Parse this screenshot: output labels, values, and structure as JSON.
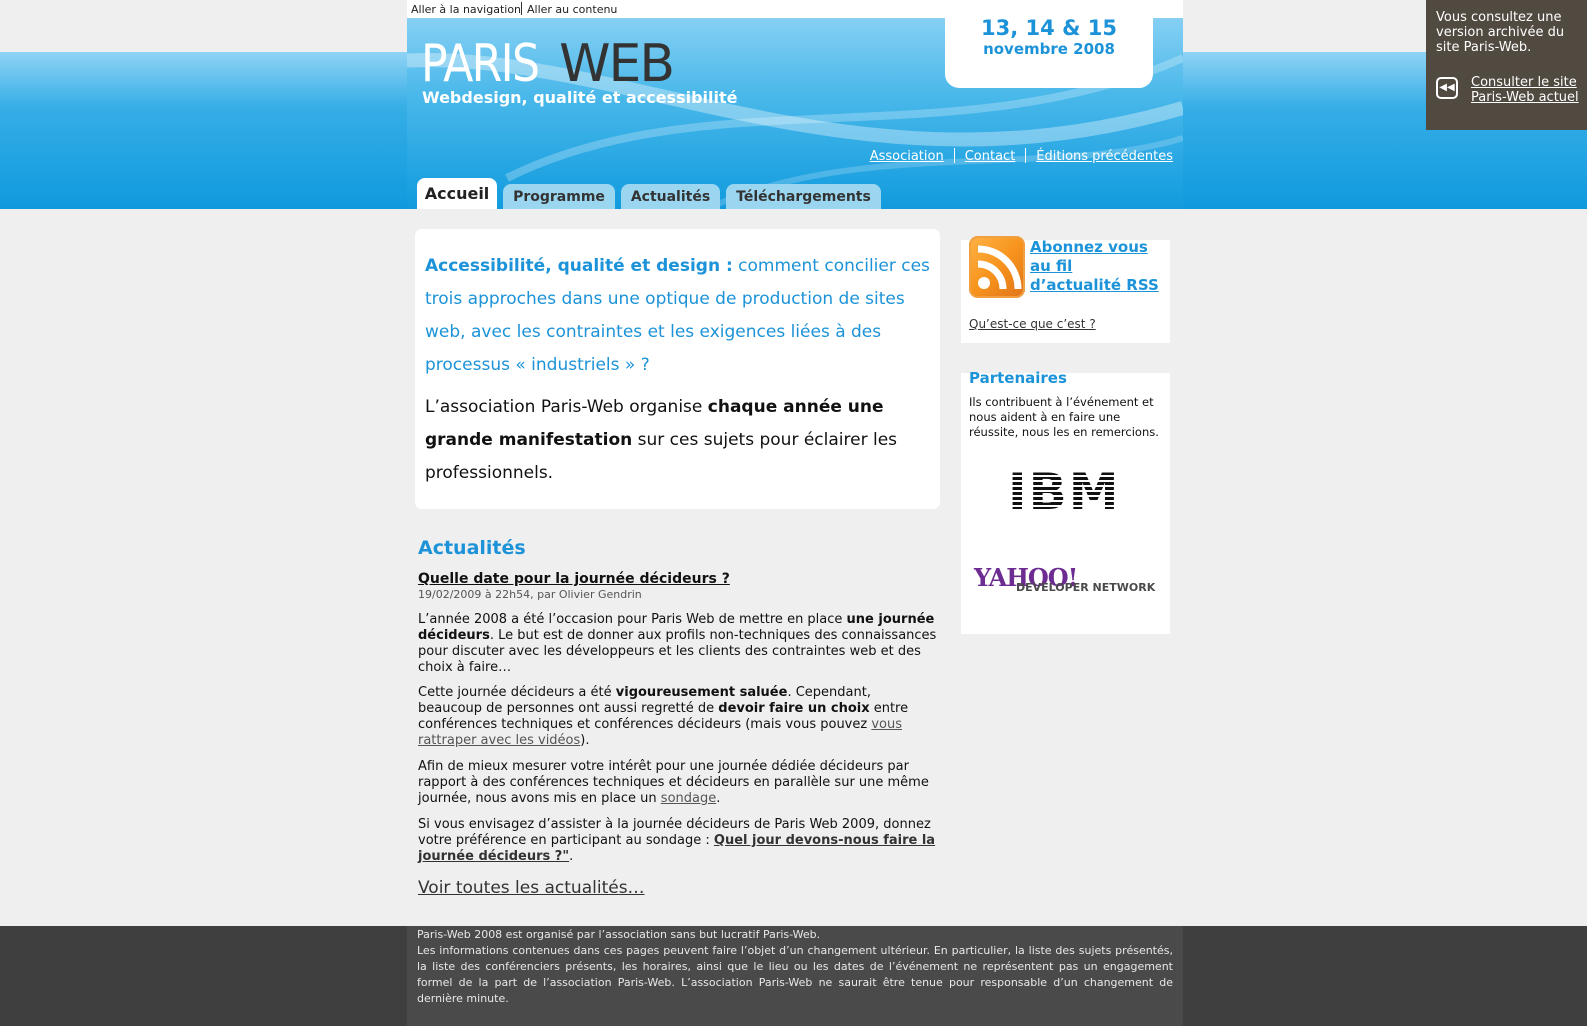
{
  "skip_links": [
    "Aller à la navigation",
    "Aller au contenu"
  ],
  "logo": {
    "part1": "PARIS",
    "part2": "WEB"
  },
  "tagline": "Webdesign, qualité et accessibilité",
  "dates": {
    "line1": "13, 14 & 15",
    "line2": "novembre 2008"
  },
  "util_nav": [
    "Association",
    "Contact",
    "Éditions précédentes"
  ],
  "tabs": [
    "Accueil",
    "Programme",
    "Actualités",
    "Téléchargements"
  ],
  "intro": {
    "lead_bold": "Accessibilité, qualité et design :",
    "lead_rest": " comment concilier ces trois approches dans une optique de production de sites web, avec les contraintes et les exigences liées à des processus « industriels » ?",
    "body_a": "L’association Paris-Web organise ",
    "body_bold": "chaque année une grande manifestation",
    "body_b": " sur ces sujets pour éclairer les professionnels."
  },
  "news": {
    "heading": "Actualités",
    "title": "Quelle date pour la journée décideurs ?",
    "meta": "19/02/2009 à 22h54, par Olivier Gendrin",
    "p1a": "L’année 2008 a été l’occasion pour Paris Web de mettre en place ",
    "p1b": "une journée décideurs",
    "p1c": ". Le but est de donner aux profils non-techniques des connaissances pour discuter avec les développeurs et les clients des contraintes web et des choix à faire…",
    "p2a": "Cette journée décideurs a été ",
    "p2b": "vigoureusement saluée",
    "p2c": ". Cependant, beaucoup de personnes ont aussi regretté de ",
    "p2d": "devoir faire un choix",
    "p2e": " entre conférences techniques et conférences décideurs (mais vous pouvez ",
    "p2link": "vous rattraper avec les vidéos",
    "p2f": ").",
    "p3a": "Afin de mieux mesurer votre intérêt pour une journée dédiée décideurs par rapport à des conférences techniques et décideurs en parallèle sur une même journée, nous avons mis en place un ",
    "p3link": "sondage",
    "p3b": ".",
    "p4a": "Si vous envisagez d’assister à la journée décideurs de Paris Web 2009, donnez votre préférence en participant au sondage : ",
    "p4link": "Quel jour devons-nous faire la journée décideurs ?\"",
    "p4b": ".",
    "all_link": "Voir toutes les actualités…"
  },
  "rss": {
    "link": "Abonnez vous au fil d’actualité RSS",
    "what": "Qu’est-ce que c’est ?"
  },
  "partners": {
    "heading": "Partenaires",
    "text": "Ils contribuent à l’événement et nous aident à en faire une réussite, nous les en remercions.",
    "ibm": "IBM",
    "yahoo": "YAHOO!",
    "yahoo_sub": "DEVELOPER NETWORK"
  },
  "archive": {
    "text": "Vous consultez une version archivée du site Paris-Web.",
    "link": "Consulter le site Paris-Web actuel"
  },
  "footer": {
    "line1": "Paris-Web 2008 est organisé par l’association sans but lucratif Paris-Web.",
    "line2": "Les informations contenues dans ces pages peuvent faire l’objet d’un changement ultérieur. En particulier, la liste des sujets présentés, la liste des conférenciers présents, les horaires, ainsi que le lieu ou les dates de l’événement ne représentent pas un engagement formel de la part de l’association Paris-Web. L’association Paris-Web ne saurait être tenue pour responsable d’un changement de dernière minute."
  },
  "colors": {
    "accent": "#1c93d8",
    "header_blue": "#119bde",
    "footer": "#4a4a4a",
    "archive_bg": "#514a40"
  }
}
